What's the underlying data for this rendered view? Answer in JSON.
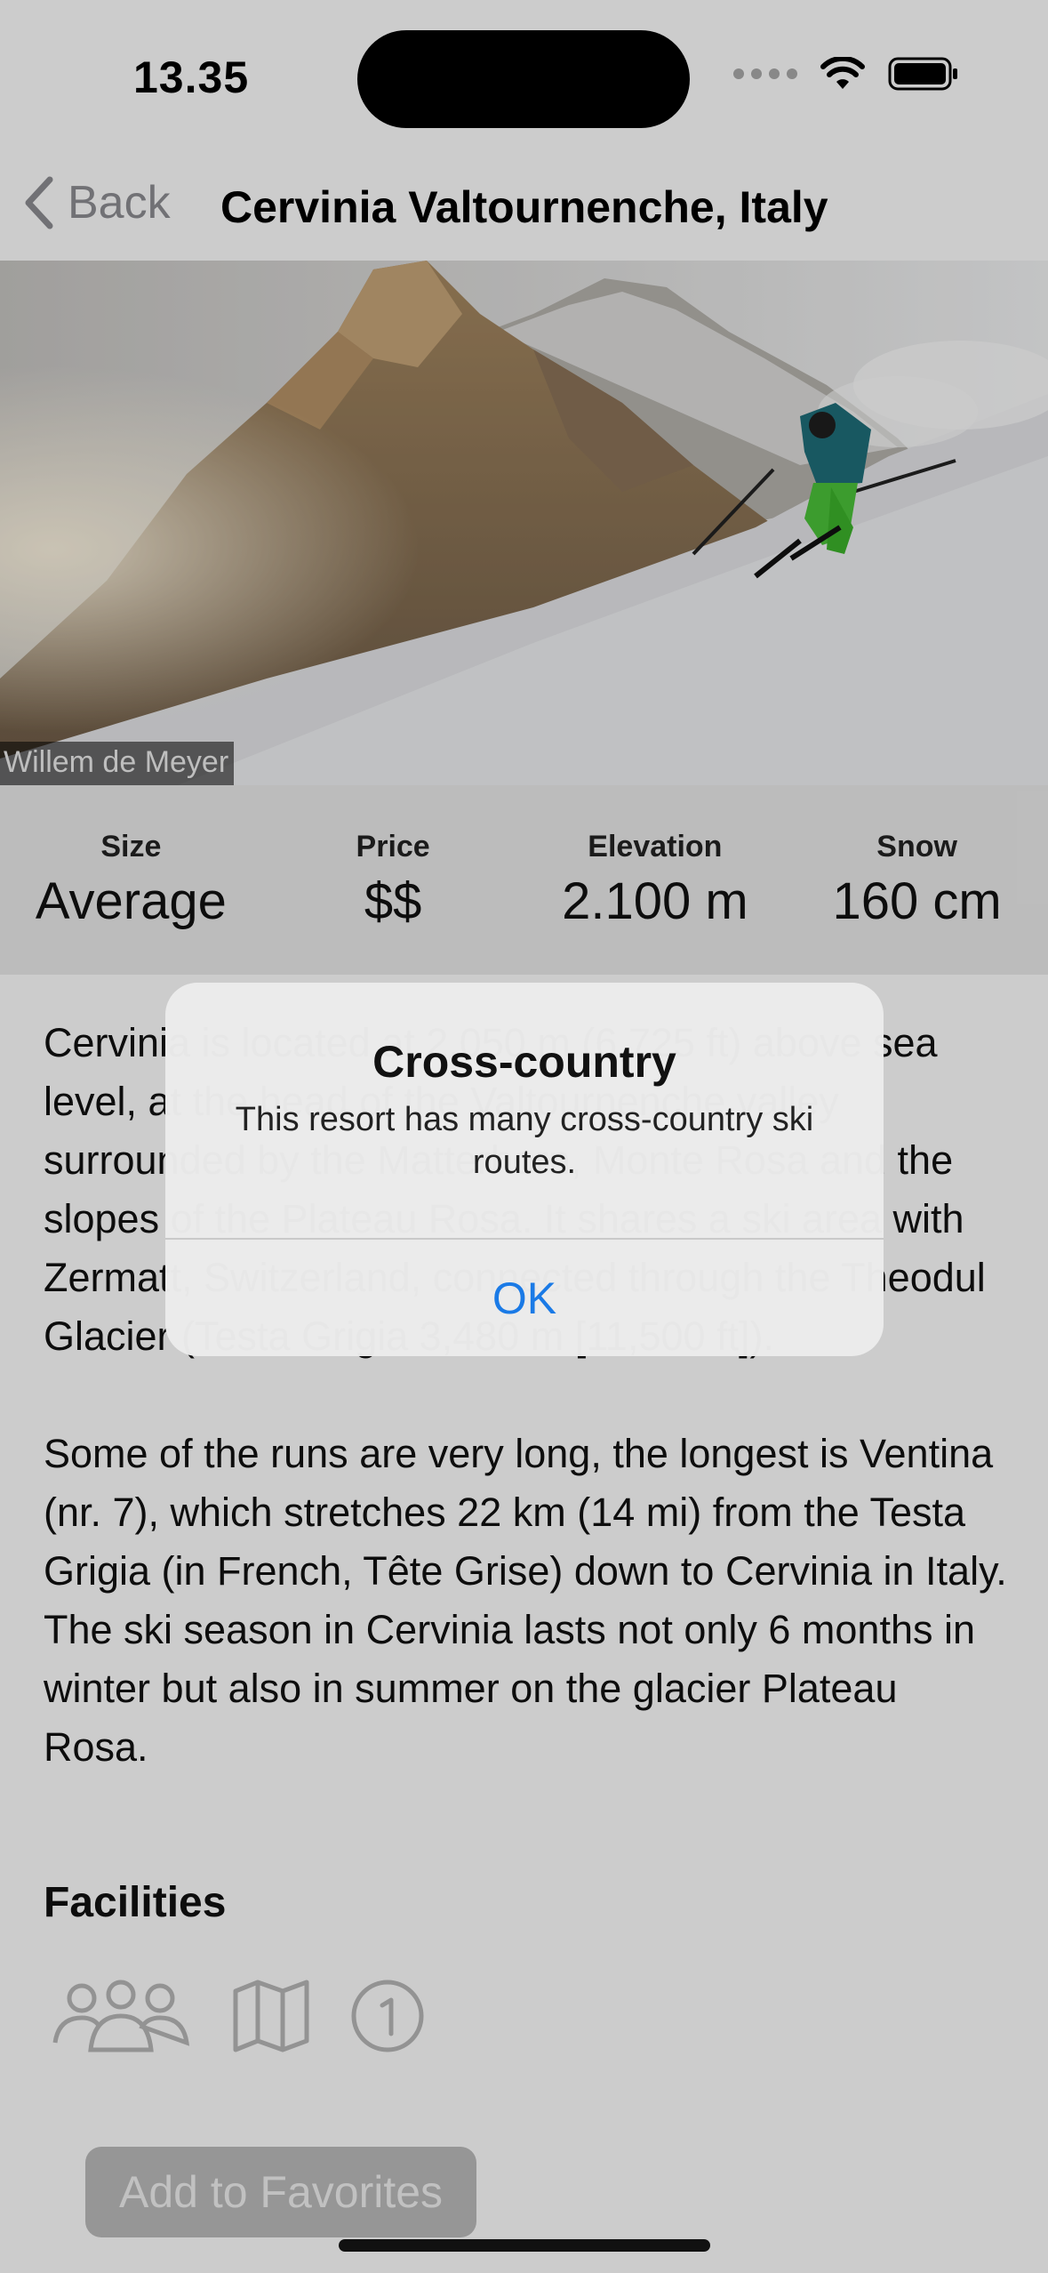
{
  "status_bar": {
    "time": "13.35"
  },
  "nav": {
    "back_label": "Back",
    "title": "Cervinia Valtournenche, Italy"
  },
  "hero": {
    "photo_credit": "Willem de Meyer"
  },
  "stats": [
    {
      "label": "Size",
      "value": "Average"
    },
    {
      "label": "Price",
      "value": "$$"
    },
    {
      "label": "Elevation",
      "value": "2.100 m"
    },
    {
      "label": "Snow",
      "value": "160 cm"
    }
  ],
  "description": "Cervinia is located at 2,050 m (6,725 ft) above sea level, at the head of the Valtournenche valley surrounded by the Matterhorn, Monte Rosa and the slopes of the Plateau Rosa. It shares a ski area with Zermatt, Switzerland, connected through the Theodul Glacier (Testa Grigia 3,480 m [11,500 ft]).\n\nSome of the runs are very long, the longest is Ventina (nr. 7), which stretches 22 km (14 mi) from the Testa Grigia (in French, Tête Grise) down to Cervinia in Italy. The ski season in Cervinia lasts not only 6 months in winter but also in summer on the glacier Plateau Rosa.",
  "facilities": {
    "title": "Facilities",
    "icons": [
      "family-icon",
      "map-icon",
      "number-one-circle-icon"
    ]
  },
  "favorites_button": "Add to Favorites",
  "alert": {
    "title": "Cross-country",
    "message": "This resort has many cross-country ski routes.",
    "ok_label": "OK"
  }
}
